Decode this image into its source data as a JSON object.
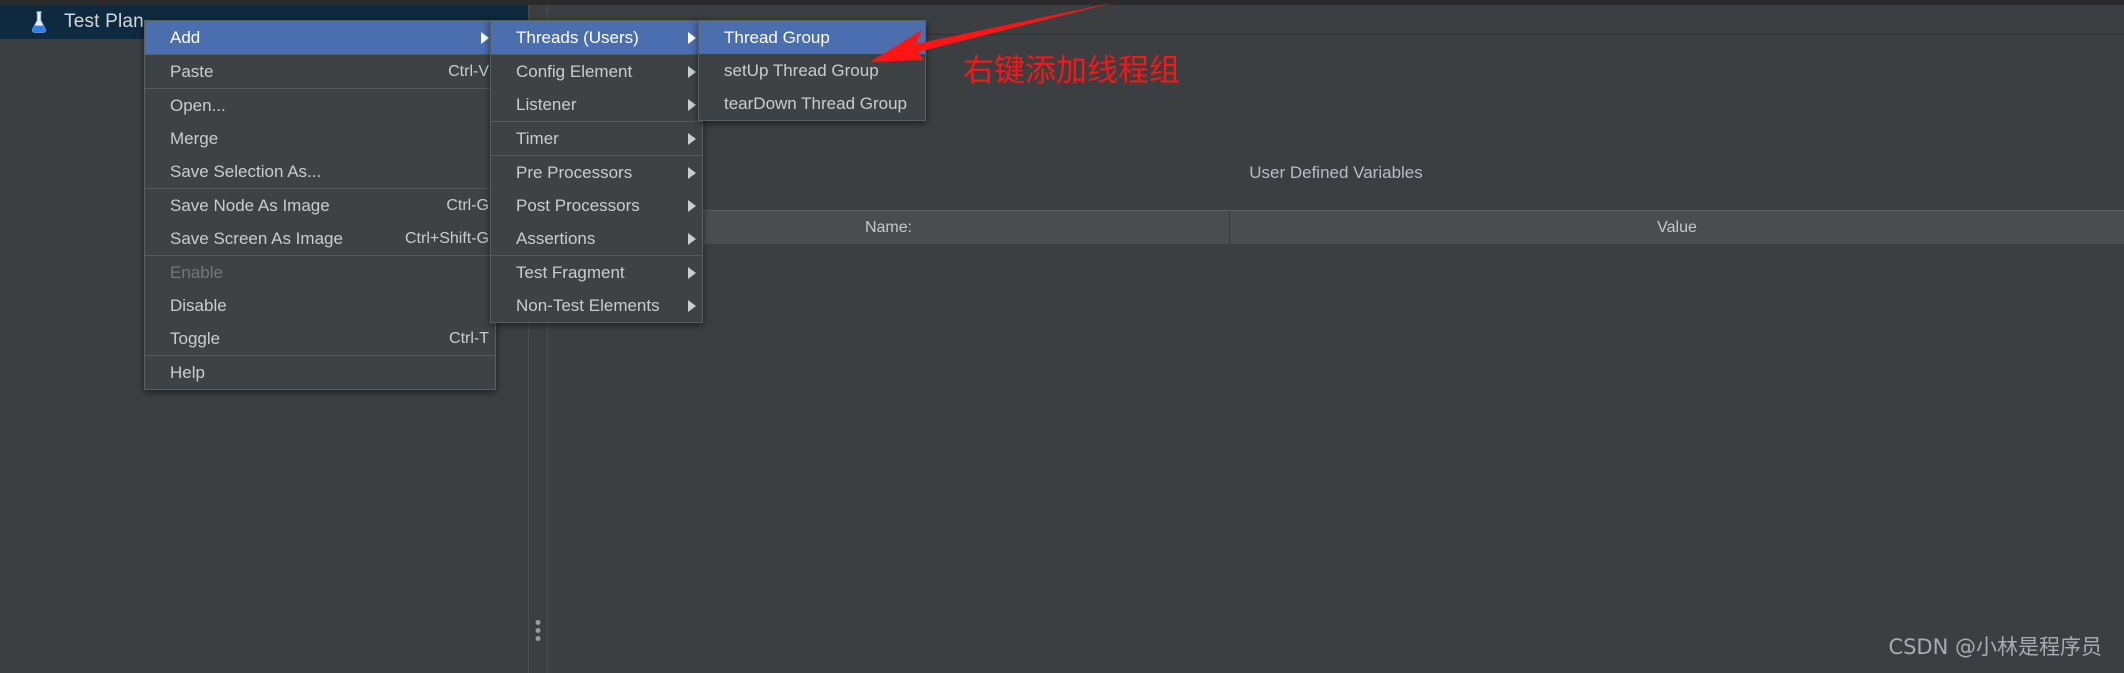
{
  "app": {
    "tree_tab_label": "Test Plan",
    "tree_tab_icon": "jmeter-flask-icon"
  },
  "right_panel": {
    "section_title": "User Defined Variables",
    "table": {
      "columns": [
        "Name:",
        "Value"
      ],
      "rows": []
    }
  },
  "context_menu": {
    "items": [
      {
        "label": "Add",
        "accel": "",
        "submenu": true,
        "selected": true,
        "disabled": false,
        "sep_after": true
      },
      {
        "label": "Paste",
        "accel": "Ctrl-V",
        "submenu": false,
        "selected": false,
        "disabled": false,
        "sep_after": true
      },
      {
        "label": "Open...",
        "accel": "",
        "submenu": false,
        "selected": false,
        "disabled": false,
        "sep_after": false
      },
      {
        "label": "Merge",
        "accel": "",
        "submenu": false,
        "selected": false,
        "disabled": false,
        "sep_after": false
      },
      {
        "label": "Save Selection As...",
        "accel": "",
        "submenu": false,
        "selected": false,
        "disabled": false,
        "sep_after": true
      },
      {
        "label": "Save Node As Image",
        "accel": "Ctrl-G",
        "submenu": false,
        "selected": false,
        "disabled": false,
        "sep_after": false
      },
      {
        "label": "Save Screen As Image",
        "accel": "Ctrl+Shift-G",
        "submenu": false,
        "selected": false,
        "disabled": false,
        "sep_after": true
      },
      {
        "label": "Enable",
        "accel": "",
        "submenu": false,
        "selected": false,
        "disabled": true,
        "sep_after": false
      },
      {
        "label": "Disable",
        "accel": "",
        "submenu": false,
        "selected": false,
        "disabled": false,
        "sep_after": false
      },
      {
        "label": "Toggle",
        "accel": "Ctrl-T",
        "submenu": false,
        "selected": false,
        "disabled": false,
        "sep_after": true
      },
      {
        "label": "Help",
        "accel": "",
        "submenu": false,
        "selected": false,
        "disabled": false,
        "sep_after": false
      }
    ]
  },
  "add_submenu": {
    "items": [
      {
        "label": "Threads (Users)",
        "submenu": true,
        "selected": true,
        "sep_after": true
      },
      {
        "label": "Config Element",
        "submenu": true,
        "selected": false,
        "sep_after": false
      },
      {
        "label": "Listener",
        "submenu": true,
        "selected": false,
        "sep_after": true
      },
      {
        "label": "Timer",
        "submenu": true,
        "selected": false,
        "sep_after": true
      },
      {
        "label": "Pre Processors",
        "submenu": true,
        "selected": false,
        "sep_after": false
      },
      {
        "label": "Post Processors",
        "submenu": true,
        "selected": false,
        "sep_after": false
      },
      {
        "label": "Assertions",
        "submenu": true,
        "selected": false,
        "sep_after": true
      },
      {
        "label": "Test Fragment",
        "submenu": true,
        "selected": false,
        "sep_after": false
      },
      {
        "label": "Non-Test Elements",
        "submenu": true,
        "selected": false,
        "sep_after": false
      }
    ]
  },
  "threads_submenu": {
    "items": [
      {
        "label": "Thread Group",
        "selected": true
      },
      {
        "label": "setUp Thread Group",
        "selected": false
      },
      {
        "label": "tearDown Thread Group",
        "selected": false
      }
    ]
  },
  "annotation": {
    "text": "右键添加线程组",
    "color": "#fb1515",
    "arrow": "red-arrow-pointing-left"
  },
  "watermark": {
    "text": "CSDN @小林是程序员"
  },
  "colors": {
    "window_bg": "#3c3f41",
    "menu_bg": "#3f4244",
    "menu_border": "#5c5f61",
    "selection": "#4b6eaf",
    "tab_bg": "#0d2a41",
    "table_header_bg": "#4a4d4f",
    "text": "#c9cdd0",
    "disabled_text": "#74777a",
    "annotation_red": "#fb1515"
  }
}
